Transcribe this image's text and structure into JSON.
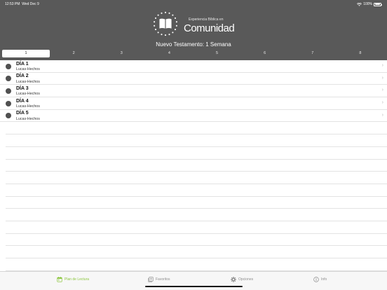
{
  "status_bar": {
    "time": "12:53 PM",
    "date": "Wed Dec 9",
    "battery": "100%"
  },
  "logo": {
    "subtitle": "Experiencia Bíblica en",
    "title": "Comunidad"
  },
  "plan_title": "Nuevo Testamento: 1 Semana",
  "segments": [
    "1",
    "2",
    "3",
    "4",
    "5",
    "6",
    "7",
    "8"
  ],
  "selected_segment": "1",
  "days": [
    {
      "title": "DÍA 1",
      "subtitle": "Lucas-Hechos"
    },
    {
      "title": "DÍA 2",
      "subtitle": "Lucas-Hechos"
    },
    {
      "title": "DÍA 3",
      "subtitle": "Lucas-Hechos"
    },
    {
      "title": "DÍA 4",
      "subtitle": "Lucas-Hechos"
    },
    {
      "title": "DÍA 5",
      "subtitle": "Lucas-Hechos"
    }
  ],
  "tabbar": {
    "plan": "Plan de Lectura",
    "favorites": "Favoritos",
    "options": "Opciones",
    "info": "Info"
  },
  "colors": {
    "header": "#595959",
    "accent": "#8cc63f",
    "dot": "#505050"
  }
}
